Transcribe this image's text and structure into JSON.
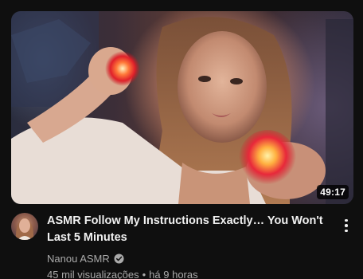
{
  "video": {
    "title": "ASMR Follow My Instructions Exactly… You Won't Last 5 Minutes",
    "duration": "49:17",
    "channel": "Nanou ASMR",
    "channel_verified_icon": "verified-check-icon",
    "views": "45 mil visualizações",
    "separator": "•",
    "published": "há 9 horas",
    "more_icon": "more-vert-icon"
  },
  "colors": {
    "background": "#0f0f0f",
    "title_text": "#f1f1f1",
    "secondary_text": "#aaaaaa",
    "duration_badge": "#000000"
  }
}
